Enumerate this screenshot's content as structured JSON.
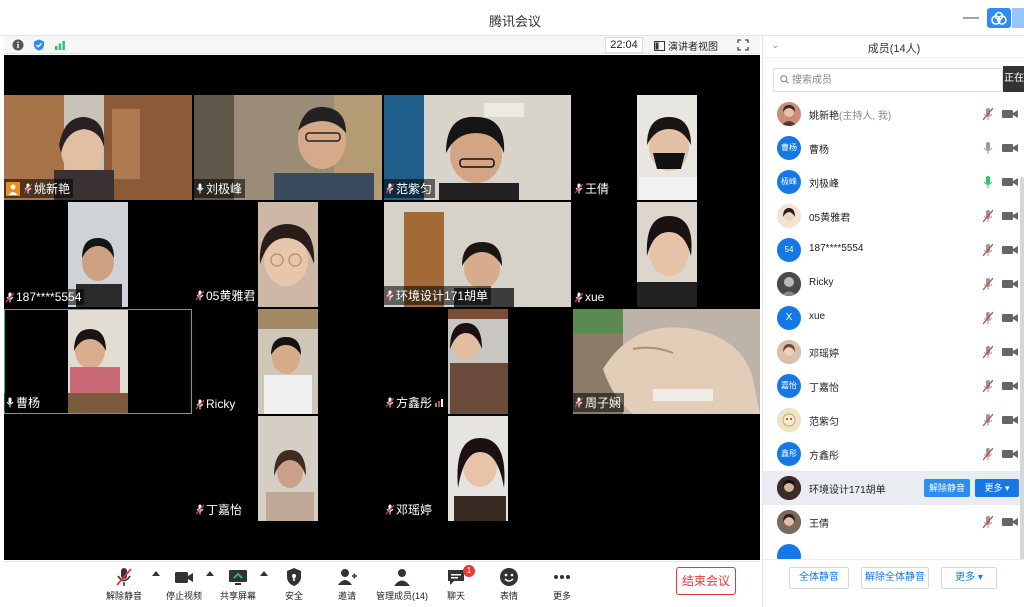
{
  "window": {
    "title": "腾讯会议"
  },
  "topbar": {
    "time": "22:04",
    "view_label": "演讲者视图"
  },
  "tiles": [
    {
      "name": "姚新艳",
      "host": true
    },
    {
      "name": "刘极峰"
    },
    {
      "name": "范紫匀"
    },
    {
      "name": "王倩"
    },
    {
      "name": "187****5554"
    },
    {
      "name": "05黄雅君"
    },
    {
      "name": "环境设计171胡单"
    },
    {
      "name": "xue"
    },
    {
      "name": "曹杨",
      "mic_on": true
    },
    {
      "name": "Ricky"
    },
    {
      "name": "方鑫彤"
    },
    {
      "name": "周子娴"
    },
    {
      "name": "丁嘉怡"
    },
    {
      "name": "邓瑶婷"
    }
  ],
  "toolbar": {
    "unmute": "解除静音",
    "stop_video": "停止视频",
    "share_screen": "共享屏幕",
    "security": "安全",
    "invite": "邀请",
    "manage": "管理成员(14)",
    "chat": "聊天",
    "chat_badge": "1",
    "emoji": "表情",
    "more": "更多",
    "end": "结束会议"
  },
  "panel": {
    "title": "成员(14人)",
    "search_placeholder": "搜索成员",
    "tag": "正在",
    "members": [
      {
        "name": "姚新艳",
        "sub": "(主持人, 我)",
        "avatar_text": "",
        "avatar_color": "#c98b7a"
      },
      {
        "name": "曹杨",
        "avatar_text": "曹杨",
        "avatar_color": "#1677e6"
      },
      {
        "name": "刘极峰",
        "avatar_text": "极峰",
        "avatar_color": "#1677e6"
      },
      {
        "name": "05黄雅君",
        "avatar_text": "",
        "avatar_color": "#f0e4d8"
      },
      {
        "name": "187****5554",
        "avatar_text": "54",
        "avatar_color": "#1677e6"
      },
      {
        "name": "Ricky",
        "avatar_text": "",
        "avatar_color": "#555555"
      },
      {
        "name": "xue",
        "avatar_text": "X",
        "avatar_color": "#1677e6"
      },
      {
        "name": "邓瑶婷",
        "avatar_text": "",
        "avatar_color": "#b58a6a"
      },
      {
        "name": "丁嘉怡",
        "avatar_text": "嘉怡",
        "avatar_color": "#1677e6"
      },
      {
        "name": "范紫匀",
        "avatar_text": "",
        "avatar_color": "#e8d9b8"
      },
      {
        "name": "方鑫彤",
        "avatar_text": "鑫彤",
        "avatar_color": "#1677e6"
      },
      {
        "name": "环境设计171胡单",
        "avatar_text": "",
        "avatar_color": "#3a2c28"
      },
      {
        "name": "王倩",
        "avatar_text": "",
        "avatar_color": "#6b5a50"
      }
    ],
    "row_unmute": "解除静音",
    "row_more": "更多",
    "mute_all": "全体静音",
    "unmute_all": "解除全体静音",
    "more": "更多"
  },
  "colors": {
    "accent": "#1677e6",
    "end": "#e4393c",
    "mic_on": "#30c36a",
    "muted": "#e4393c"
  }
}
